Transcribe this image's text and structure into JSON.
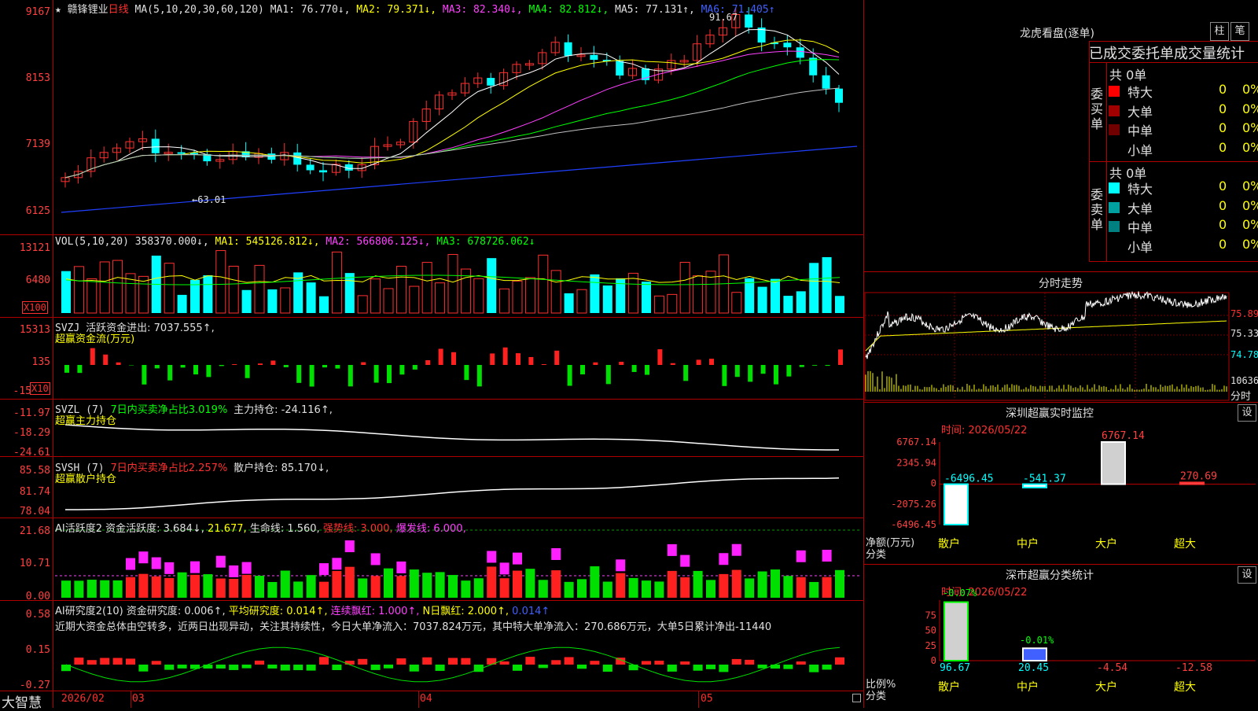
{
  "header": {
    "star": "★",
    "stock_name": "赣锋锂业",
    "period": "日线",
    "ma_params": "MA(5,10,20,30,60,120)",
    "ma1": "MA1: 76.770↓,",
    "ma2": "MA2: 79.371↓,",
    "ma3": "MA3: 82.340↓,",
    "ma4": "MA4: 82.812↓,",
    "ma5": "MA5: 77.131↑,",
    "ma6": "MA6: 71.405↑"
  },
  "price_axis": [
    "9167",
    "8153",
    "7139",
    "6125"
  ],
  "price_markers": {
    "high": "91.67",
    "low": "←63.01"
  },
  "vol": {
    "label": "VOL(5,10,20)",
    "value": "358370.000↓,",
    "ma1": "MA1: 545126.812↓,",
    "ma2": "MA2: 566806.125↓,",
    "ma3": "MA3: 678726.062↓",
    "axis": [
      "13121",
      "6480"
    ],
    "unit": "X100"
  },
  "svzj": {
    "label": "SVZJ",
    "text": "活跃资金进出: 7037.555↑,",
    "subtitle": "超赢资金流(万元)",
    "axis": [
      "15313",
      "135",
      "-15"
    ],
    "unit": "X10"
  },
  "svzl": {
    "label": "SVZL (7)",
    "ratio": "7日内买卖净占比3.019%",
    "text": "主力持仓: -24.116↑,",
    "subtitle": "超赢主力持仓",
    "axis": [
      "-11.97",
      "-18.29",
      "-24.61"
    ]
  },
  "svsh": {
    "label": "SVSH (7)",
    "ratio": "7日内买卖净占比2.257%",
    "text": "散户持仓: 85.170↓,",
    "subtitle": "超赢散户持仓",
    "axis": [
      "85.58",
      "81.74",
      "78.04"
    ]
  },
  "ai_active": {
    "label": "AI活跃度2",
    "t1": "资金活跃度: 3.684↓,",
    "t2": "21.677,",
    "t3": "生命线: 1.560,",
    "t4": "强势线: 3.000,",
    "t5": "爆发线: 6.000,",
    "axis": [
      "21.68",
      "10.71",
      "0.00"
    ]
  },
  "ai_research": {
    "label": "AI研究度2(10)",
    "t1": "资金研究度: 0.006↑,",
    "t2": "平均研究度: 0.014↑,",
    "t3": "连续飘红: 1.000↑,",
    "t4": "N日飘红: 2.000↑,",
    "t5": "0.014↑",
    "comment": "近期大资金总体由空转多，近两日出现异动，关注其持续性，今日大单净流入：7037.824万元，其中特大单净流入：270.686万元，大单5日累计净出-11440",
    "axis": [
      "0.58",
      "0.15",
      "-0.27"
    ]
  },
  "footer": {
    "brand": "大智慧",
    "dates": [
      "2026/02",
      "03",
      "04",
      "05"
    ]
  },
  "longhu": {
    "title": "龙虎看盘(逐单)",
    "btn_bar": "柱",
    "btn_pen": "笔",
    "subtitle": "已成交委托单成交量统计",
    "buy_label": "委买单",
    "sell_label": "委卖单",
    "buy_total": "共 0单",
    "sell_total": "共 0单",
    "buy_rows": [
      {
        "name": "特大",
        "count": "0",
        "pct": "0%",
        "color": "#ff0000"
      },
      {
        "name": "大单",
        "count": "0",
        "pct": "0%",
        "color": "#a00000"
      },
      {
        "name": "中单",
        "count": "0",
        "pct": "0%",
        "color": "#700000"
      },
      {
        "name": "小单",
        "count": "0",
        "pct": "0%",
        "color": ""
      }
    ],
    "sell_rows": [
      {
        "name": "特大",
        "count": "0",
        "pct": "0%",
        "color": "#00ffff"
      },
      {
        "name": "大单",
        "count": "0",
        "pct": "0%",
        "color": "#00a0a0"
      },
      {
        "name": "中单",
        "count": "0",
        "pct": "0%",
        "color": "#008080"
      },
      {
        "name": "小单",
        "count": "0",
        "pct": "0%",
        "color": ""
      }
    ]
  },
  "intraday": {
    "title": "分时走势",
    "axis": [
      "75.89",
      "75.33",
      "74.78",
      "10636",
      "分时"
    ]
  },
  "sz_monitor": {
    "title": "深圳超赢实时监控",
    "btn": "设",
    "time": "时间: 2026/05/22",
    "axis": [
      "6767.14",
      "2345.94",
      "0",
      "-2075.26",
      "-6496.45"
    ],
    "ylabel": "净额(万元)",
    "xlabel": "分类",
    "categories": [
      "散户",
      "中户",
      "大户",
      "超大"
    ],
    "values": [
      "-6496.45",
      "-541.37",
      "6767.14",
      "270.69"
    ]
  },
  "sz_class": {
    "title": "深市超赢分类统计",
    "btn": "设",
    "time": "时间: 2026/05/22",
    "axis": [
      "75",
      "50",
      "25",
      "0"
    ],
    "ylabel": "比例%",
    "xlabel": "分类",
    "categories": [
      "散户",
      "中户",
      "大户",
      "超大"
    ],
    "top_values": [
      "-0.07%",
      "-0.01%"
    ],
    "values": [
      "96.67",
      "20.45",
      "-4.54",
      "-12.58"
    ]
  },
  "chart_data": [
    {
      "type": "bar",
      "title": "深圳超赢实时监控",
      "categories": [
        "散户",
        "中户",
        "大户",
        "超大"
      ],
      "values": [
        -6496.45,
        -541.37,
        6767.14,
        270.69
      ],
      "ylabel": "净额(万元)",
      "xlabel": "分类",
      "ylim": [
        -6496.45,
        6767.14
      ]
    },
    {
      "type": "bar",
      "title": "深市超赢分类统计",
      "categories": [
        "散户",
        "中户",
        "大户",
        "超大"
      ],
      "values": [
        96.67,
        20.45,
        -4.54,
        -12.58
      ],
      "ylabel": "比例%",
      "xlabel": "分类",
      "ylim": [
        0,
        100
      ]
    }
  ]
}
